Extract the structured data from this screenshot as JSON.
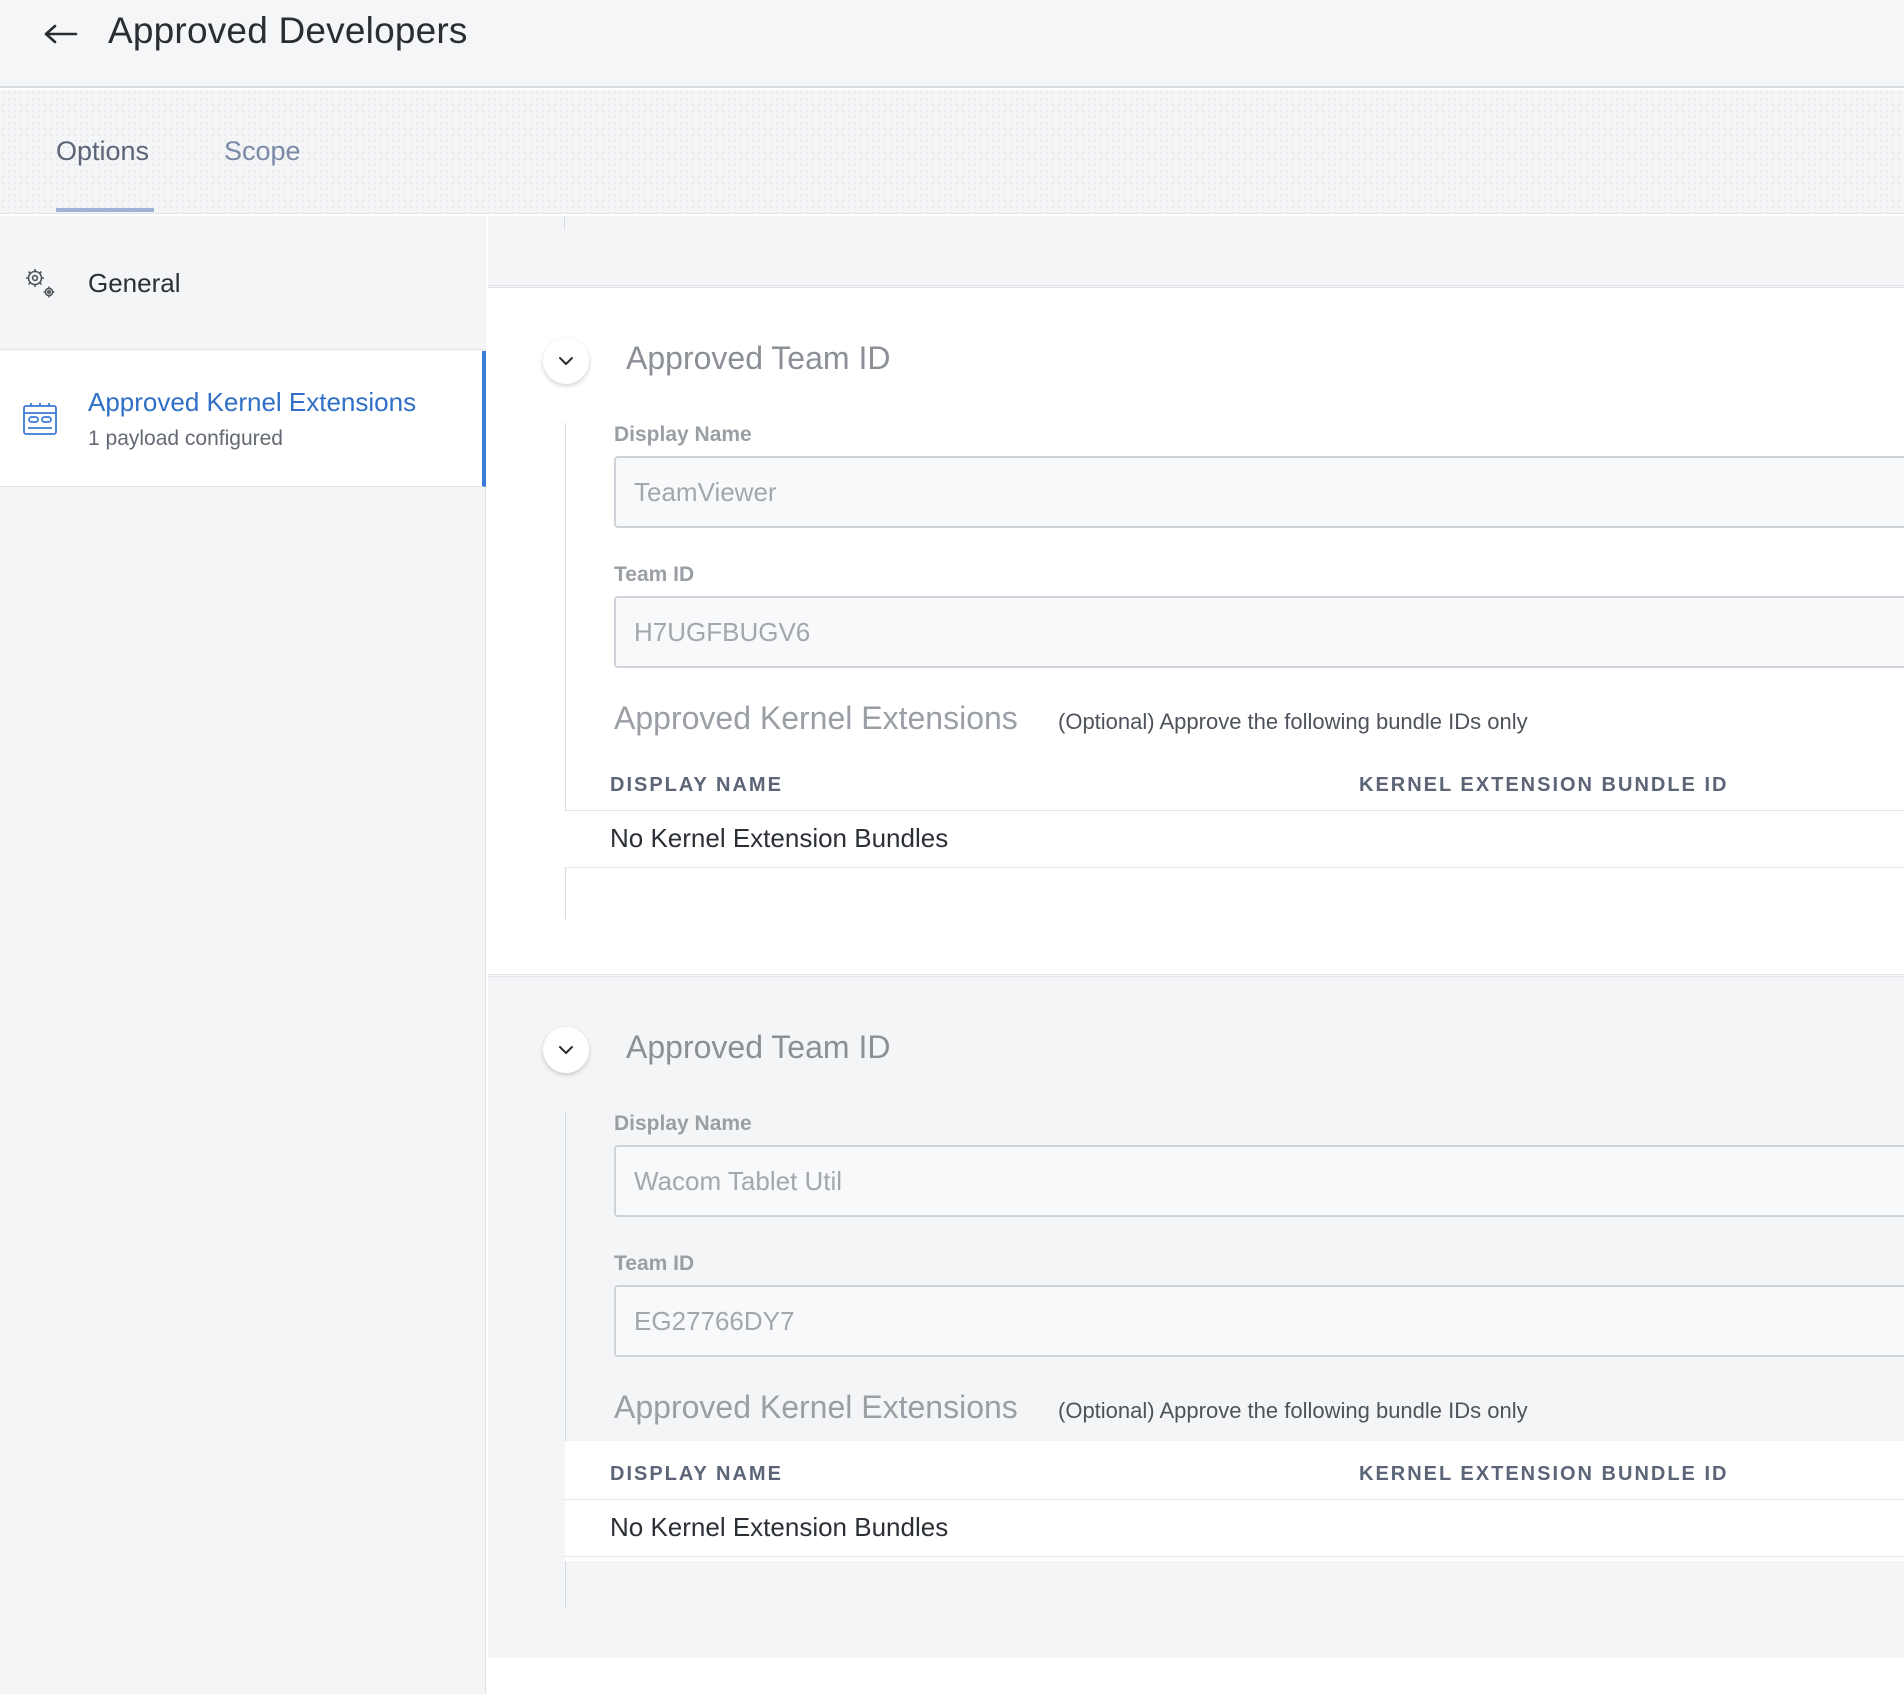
{
  "header": {
    "title": "Approved Developers",
    "back_icon": "arrow-left-icon"
  },
  "tabs": [
    {
      "label": "Options",
      "active": true
    },
    {
      "label": "Scope",
      "active": false
    }
  ],
  "sidebar": {
    "items": [
      {
        "label": "General",
        "icon": "gear-icon"
      },
      {
        "label": "Approved Kernel Extensions",
        "sublabel": "1 payload configured",
        "icon": "kernel-extension-icon",
        "selected": true
      }
    ]
  },
  "cards": [
    {
      "title": "Approved Team ID",
      "display_name_label": "Display Name",
      "display_name_value": "TeamViewer",
      "team_id_label": "Team ID",
      "team_id_value": "H7UGFBUGV6",
      "kext_title": "Approved Kernel Extensions",
      "kext_note": "(Optional) Approve the following bundle IDs only",
      "table": {
        "headers": [
          "DISPLAY NAME",
          "KERNEL EXTENSION BUNDLE ID"
        ],
        "empty_text": "No Kernel Extension Bundles"
      }
    },
    {
      "title": "Approved Team ID",
      "display_name_label": "Display Name",
      "display_name_value": "Wacom Tablet Util",
      "team_id_label": "Team ID",
      "team_id_value": "EG27766DY7",
      "kext_title": "Approved Kernel Extensions",
      "kext_note": "(Optional) Approve the following bundle IDs only",
      "table": {
        "headers": [
          "DISPLAY NAME",
          "KERNEL EXTENSION BUNDLE ID"
        ],
        "empty_text": "No Kernel Extension Bundles"
      }
    }
  ],
  "colors": {
    "accent": "#3a7bd5",
    "selected_text": "#2f6fc6",
    "tab_underline": "#9fb3d4"
  }
}
